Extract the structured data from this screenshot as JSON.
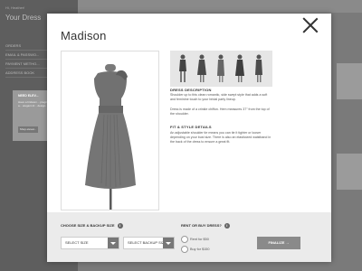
{
  "background": {
    "greeting": "Hi, Heather!",
    "title": "Your Dress",
    "menu": [
      "Orders",
      "Email & Passwo...",
      "Payment Metho...",
      "Address Book"
    ],
    "card": {
      "title": "Need Elev...",
      "text": "Have a bridesm... pregnant, a... elegant dr... design.",
      "button": "Shop elevat..."
    }
  },
  "modal": {
    "title": "Madison",
    "close_icon": "close-icon",
    "description_heading": "Dress Description",
    "description_p1": "Shoulder up to this clean romantic, side swept style that adds a soft and feminine touch to your bridal party lineup.",
    "description_p2": "Dress is made of a crinkle chiffon. Hem measures 37\" from the top of the shoulder.",
    "fit_heading": "Fit & Style Details",
    "fit_text": "An adjustable shoulder tie means you can tie it tighter or looser depending on your bust size. There is also an elasticized waistband in the back of the dress to ensure a great fit."
  },
  "footer": {
    "size_label": "Choose Size & Backup Size",
    "size_select": "Select Size",
    "backup_select": "Select Backup Size",
    "rent_label": "Rent or Buy Dress?",
    "rent_option": "Rent for $50",
    "buy_option": "Buy for $150",
    "finalize": "Finalize →",
    "info_icon": "i"
  },
  "colors": {
    "overlay": "#6f6f6f",
    "footer_bg": "#ebebeb",
    "button_bg": "#8a8a8a",
    "dress": "#6e6e6e"
  }
}
